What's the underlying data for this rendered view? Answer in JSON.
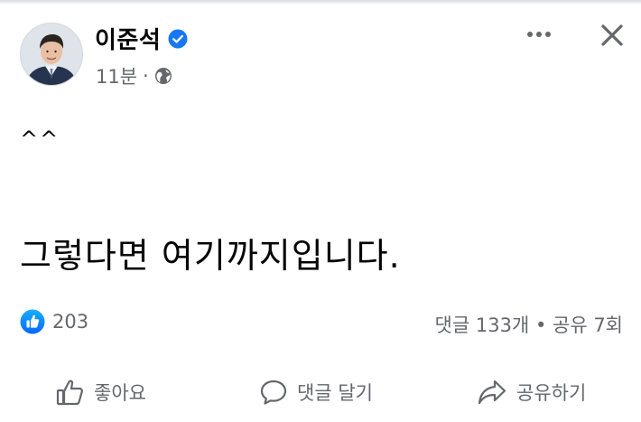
{
  "post": {
    "author_name": "이준석",
    "timestamp": "11분",
    "separator": "·",
    "emoticon": "^^",
    "text": "그렇다면 여기까지입니다.",
    "like_count": "203",
    "stats": "댓글 133개 • 공유 7회"
  },
  "actions": {
    "like_label": "좋아요",
    "comment_label": "댓글 달기",
    "share_label": "공유하기"
  },
  "colors": {
    "accent": "#1877f2",
    "secondary_text": "#65676b",
    "primary_text": "#050505"
  },
  "icons": [
    "verified-badge-icon",
    "globe-icon",
    "more-options-icon",
    "close-icon",
    "like-reaction-icon",
    "thumbs-up-icon",
    "comment-bubble-icon",
    "share-arrow-icon"
  ]
}
